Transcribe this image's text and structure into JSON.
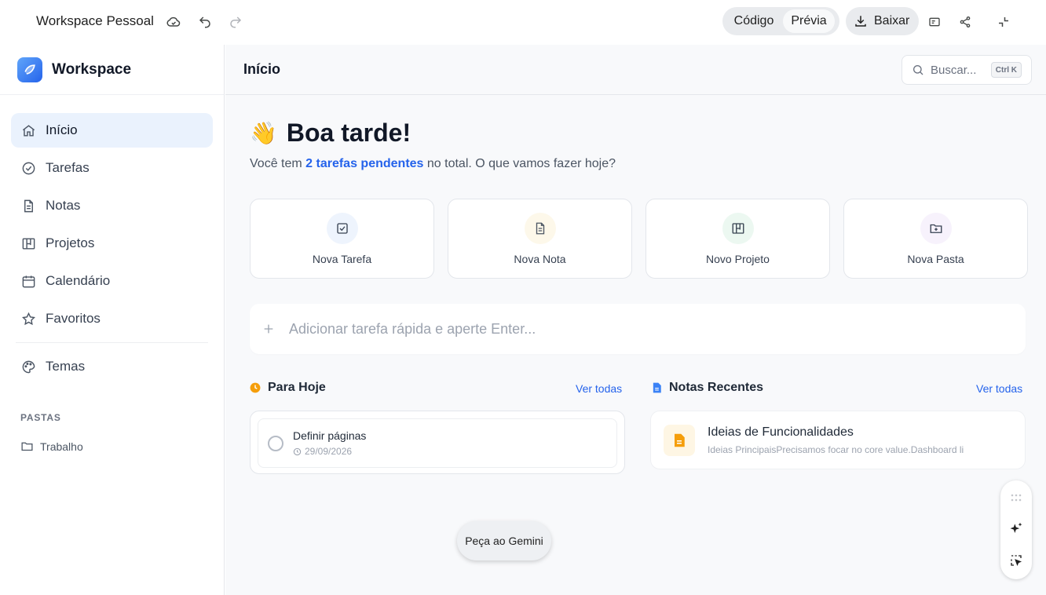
{
  "topbar": {
    "title": "Workspace Pessoal",
    "toggle_code": "Código",
    "toggle_preview": "Prévia",
    "download_label": "Baixar"
  },
  "sidebar": {
    "brand": "Workspace",
    "items": [
      {
        "label": "Início",
        "icon": "home-icon",
        "active": true
      },
      {
        "label": "Tarefas",
        "icon": "check-circle-icon"
      },
      {
        "label": "Notas",
        "icon": "document-icon"
      },
      {
        "label": "Projetos",
        "icon": "kanban-icon"
      },
      {
        "label": "Calendário",
        "icon": "calendar-icon"
      },
      {
        "label": "Favoritos",
        "icon": "star-icon"
      },
      {
        "label": "Temas",
        "icon": "palette-icon"
      }
    ],
    "section_label": "PASTAS",
    "folders": [
      {
        "label": "Trabalho",
        "icon": "folder-icon"
      }
    ]
  },
  "main": {
    "title": "Início",
    "search_placeholder": "Buscar...",
    "search_shortcut": "Ctrl K",
    "greeting_emoji": "👋",
    "greeting": "Boa tarde!",
    "subtitle_pre": "Você tem ",
    "subtitle_highlight": "2 tarefas pendentes",
    "subtitle_post": " no total. O que vamos fazer hoje?",
    "cards": [
      {
        "label": "Nova Tarefa",
        "icon": "task-icon",
        "color": "#2563eb",
        "bg": "#eef4fd"
      },
      {
        "label": "Nova Nota",
        "icon": "note-icon",
        "color": "#4b5563",
        "bg": "#fdf8ea"
      },
      {
        "label": "Novo Projeto",
        "icon": "project-icon",
        "color": "#374151",
        "bg": "#ecf8f1"
      },
      {
        "label": "Nova Pasta",
        "icon": "folder-plus-icon",
        "color": "#374151",
        "bg": "#f7f2fc"
      }
    ],
    "quick_add_placeholder": "Adicionar tarefa rápida e aperte Enter...",
    "today": {
      "title": "Para Hoje",
      "link": "Ver todas",
      "tasks": [
        {
          "title": "Definir páginas",
          "date": "29/09/2026"
        }
      ]
    },
    "notes": {
      "title": "Notas Recentes",
      "link": "Ver todas",
      "items": [
        {
          "title": "Ideias de Funcionalidades",
          "preview": "Ideias PrincipaisPrecisamos focar no core value.Dashboard li"
        }
      ]
    }
  },
  "gemini_button": "Peça ao Gemini",
  "colors": {
    "accent": "#2563eb",
    "today_icon": "#f59e0b",
    "note_icon": "#f59e0b"
  }
}
